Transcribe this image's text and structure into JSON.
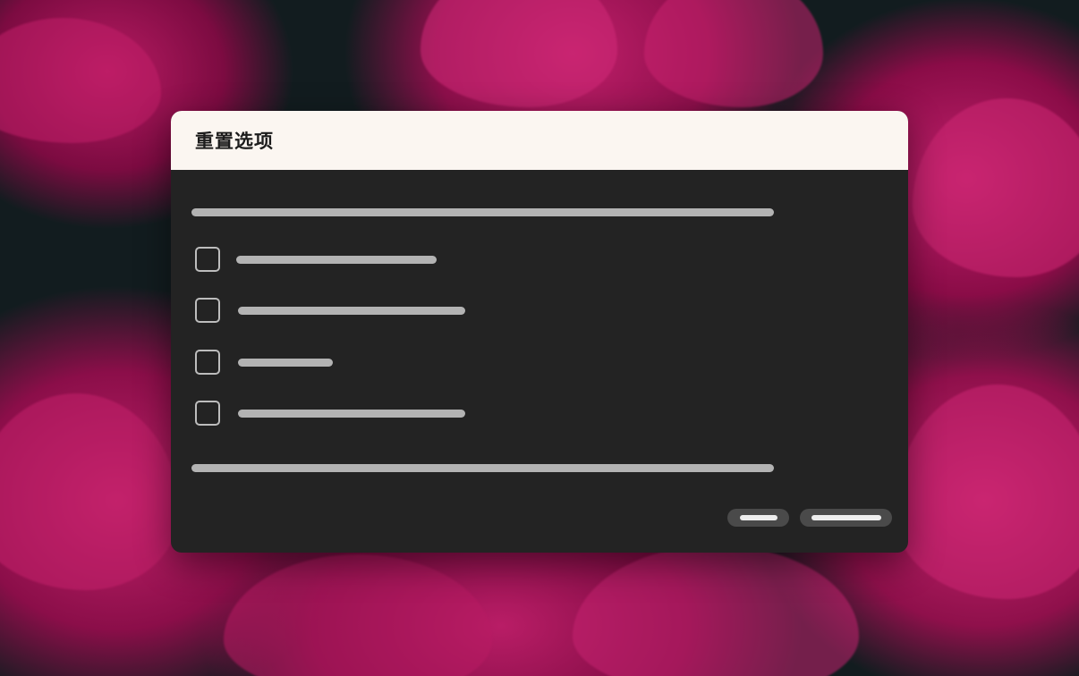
{
  "dialog": {
    "title": "重置选项"
  },
  "options": [
    {
      "checked": false
    },
    {
      "checked": false
    },
    {
      "checked": false
    },
    {
      "checked": false
    }
  ],
  "colors": {
    "header_bg": "#fbf6f1",
    "body_bg": "#232323",
    "placeholder_text": "#b3b3b3",
    "button_bg": "#4a4a4a",
    "wallpaper_accent": "#c01f6a"
  }
}
